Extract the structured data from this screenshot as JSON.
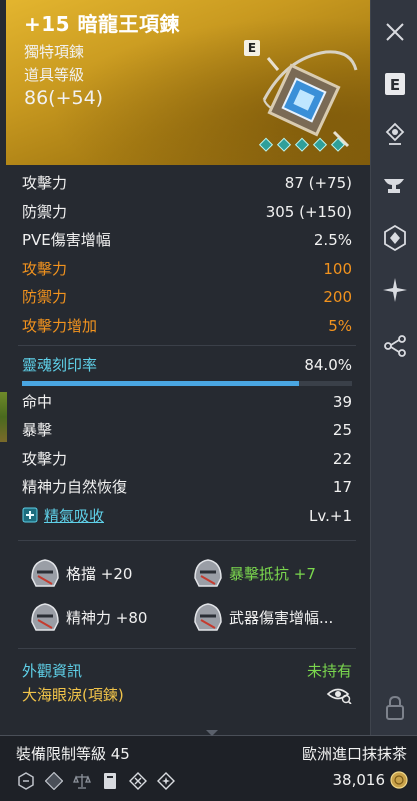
{
  "item": {
    "title": "+15 暗龍王項鍊",
    "subtype": "獨特項鍊",
    "ilvl_label": "道具等級",
    "ilvl": "86(+54)",
    "badge": "E"
  },
  "stats": [
    {
      "label": "攻擊力",
      "value": "87 (+75)",
      "color": "white"
    },
    {
      "label": "防禦力",
      "value": "305 (+150)",
      "color": "white"
    },
    {
      "label": "PVE傷害增幅",
      "value": "2.5%",
      "color": "white"
    },
    {
      "label": "攻擊力",
      "value": "100",
      "color": "orange"
    },
    {
      "label": "防禦力",
      "value": "200",
      "color": "orange"
    },
    {
      "label": "攻擊力增加",
      "value": "5%",
      "color": "orange"
    }
  ],
  "soul": {
    "label": "靈魂刻印率",
    "value": "84.0%",
    "progress": 0.84
  },
  "substats": [
    {
      "label": "命中",
      "value": "39"
    },
    {
      "label": "暴擊",
      "value": "25"
    },
    {
      "label": "攻擊力",
      "value": "22"
    },
    {
      "label": "精神力自然恢復",
      "value": "17"
    }
  ],
  "skill": {
    "label": "精氣吸收",
    "value": "Lv.+1"
  },
  "effects": [
    {
      "label": "格擋 +20",
      "color": "white"
    },
    {
      "label": "暴擊抵抗 +7",
      "color": "green"
    },
    {
      "label": "精神力 +80",
      "color": "white"
    },
    {
      "label": "武器傷害增幅...",
      "color": "white"
    }
  ],
  "appearance": {
    "label": "外觀資訊",
    "status": "未持有",
    "name": "大海眼淚(項鍊)"
  },
  "footer": {
    "equip_limit": "裝備限制等級 45",
    "owner": "歐洲進口抹抹茶",
    "price": "38,016"
  },
  "sidebar_icons": [
    "close-icon",
    "encyclopedia-icon",
    "appraise-icon",
    "anvil-icon",
    "emblem-icon",
    "spark-icon",
    "share-icon",
    "lock-icon"
  ],
  "colors": {
    "header_gold": "#c99a20",
    "orange": "#f2931e",
    "cyan": "#5fd0e8",
    "green": "#7bd84e",
    "bar": "#4aa6e2"
  }
}
